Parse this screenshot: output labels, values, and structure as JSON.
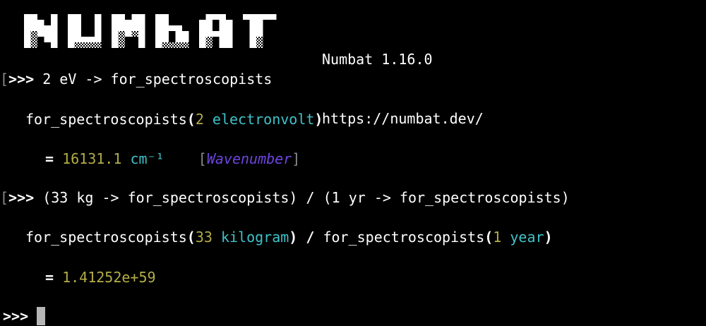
{
  "app": {
    "name_version": "Numbat 1.16.0",
    "url": "https://numbat.dev/",
    "logo_text": "NUMBAT"
  },
  "colors": {
    "background": "#000000",
    "text": "#ffffff",
    "number": "#b3ad47",
    "unit": "#40c1c9",
    "type": "#6d45e0",
    "dim": "#8a8a8a"
  },
  "session": [
    {
      "prompt_prefix": "[",
      "prompt": ">>>",
      "input": " 2 eV -> for_spectroscopists",
      "call": {
        "func": "for_spectroscopists",
        "open": "(",
        "num": "2",
        "space": " ",
        "unit": "electronvolt",
        "close": ")"
      },
      "result": {
        "eq": "=",
        "num": "16131.1",
        "unit": "cm⁻¹",
        "type_open": "[",
        "type": "Wavenumber",
        "type_close": "]"
      }
    },
    {
      "prompt_prefix": "[",
      "prompt": ">>>",
      "input": " (33 kg -> for_spectroscopists) / (1 yr -> for_spectroscopists)",
      "call": {
        "func1": "for_spectroscopists",
        "open1": "(",
        "num1": "33",
        "unit1": "kilogram",
        "close1": ")",
        "div": " / ",
        "func2": "for_spectroscopists",
        "open2": "(",
        "num2": "1",
        "unit2": "year",
        "close2": ")"
      },
      "result": {
        "eq": "=",
        "num": "1.41252e+59"
      }
    }
  ],
  "current_prompt": ">>>"
}
